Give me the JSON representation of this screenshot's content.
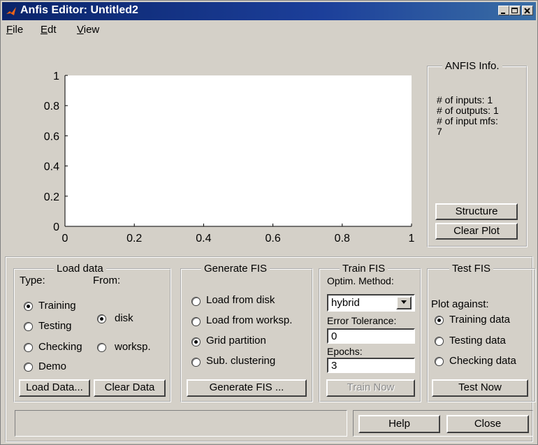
{
  "window": {
    "title": "Anfis Editor: Untitled2"
  },
  "menu": [
    {
      "label": "File",
      "mnemonic": "F",
      "rest": "ile"
    },
    {
      "label": "Edit",
      "mnemonic": "E",
      "rest": "dt"
    },
    {
      "label": "View",
      "mnemonic": "V",
      "rest": "iew"
    }
  ],
  "plot": {
    "y_ticks": [
      "1",
      "0.8",
      "0.6",
      "0.4",
      "0.2",
      "0"
    ],
    "x_ticks": [
      "0",
      "0.2",
      "0.4",
      "0.6",
      "0.8",
      "1"
    ]
  },
  "anfis_info": {
    "title": "ANFIS Info.",
    "lines": [
      "# of inputs: 1",
      "# of outputs: 1",
      "# of input mfs:",
      "7"
    ],
    "structure_btn": "Structure",
    "clear_plot_btn": "Clear Plot"
  },
  "load_data": {
    "title": "Load data",
    "type_label": "Type:",
    "from_label": "From:",
    "types": [
      {
        "label": "Training",
        "selected": true
      },
      {
        "label": "Testing",
        "selected": false
      },
      {
        "label": "Checking",
        "selected": false
      },
      {
        "label": "Demo",
        "selected": false
      }
    ],
    "sources": [
      {
        "label": "disk",
        "selected": true
      },
      {
        "label": "worksp.",
        "selected": false
      }
    ],
    "load_btn": "Load Data...",
    "clear_btn": "Clear Data"
  },
  "generate_fis": {
    "title": "Generate FIS",
    "options": [
      {
        "label": "Load from disk",
        "selected": false
      },
      {
        "label": "Load from worksp.",
        "selected": false
      },
      {
        "label": "Grid partition",
        "selected": true
      },
      {
        "label": "Sub. clustering",
        "selected": false
      }
    ],
    "button": "Generate FIS ..."
  },
  "train_fis": {
    "title": "Train FIS",
    "method_label": "Optim. Method:",
    "method_value": "hybrid",
    "error_label": "Error Tolerance:",
    "error_value": "0",
    "epochs_label": "Epochs:",
    "epochs_value": "3",
    "button": "Train Now"
  },
  "test_fis": {
    "title": "Test FIS",
    "plot_against": "Plot against:",
    "options": [
      {
        "label": "Training data",
        "selected": true
      },
      {
        "label": "Testing data",
        "selected": false
      },
      {
        "label": "Checking data",
        "selected": false
      }
    ],
    "button": "Test Now"
  },
  "footer": {
    "help_btn": "Help",
    "close_btn": "Close"
  }
}
